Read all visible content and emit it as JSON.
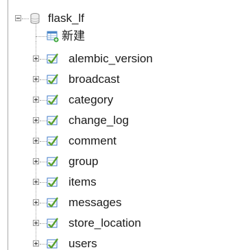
{
  "tree": {
    "database": {
      "label": "flask_lf",
      "icon": "database-icon",
      "expanded": true
    },
    "new_item": {
      "label": "新建",
      "icon": "new-table-icon"
    },
    "tables": [
      {
        "label": "alembic_version",
        "icon": "table-icon",
        "expanded": false
      },
      {
        "label": "broadcast",
        "icon": "table-icon",
        "expanded": false
      },
      {
        "label": "category",
        "icon": "table-icon",
        "expanded": false
      },
      {
        "label": "change_log",
        "icon": "table-icon",
        "expanded": false
      },
      {
        "label": "comment",
        "icon": "table-icon",
        "expanded": false
      },
      {
        "label": "group",
        "icon": "table-icon",
        "expanded": false
      },
      {
        "label": "items",
        "icon": "table-icon",
        "expanded": false
      },
      {
        "label": "messages",
        "icon": "table-icon",
        "expanded": false
      },
      {
        "label": "store_location",
        "icon": "table-icon",
        "expanded": false
      },
      {
        "label": "users",
        "icon": "table-icon",
        "expanded": false
      }
    ]
  },
  "colors": {
    "background": "#ffffff",
    "text": "#1a1a1a",
    "connector": "#9c9c9c",
    "table_icon_green": "#5aa02c",
    "table_icon_blue": "#3c78c8"
  }
}
